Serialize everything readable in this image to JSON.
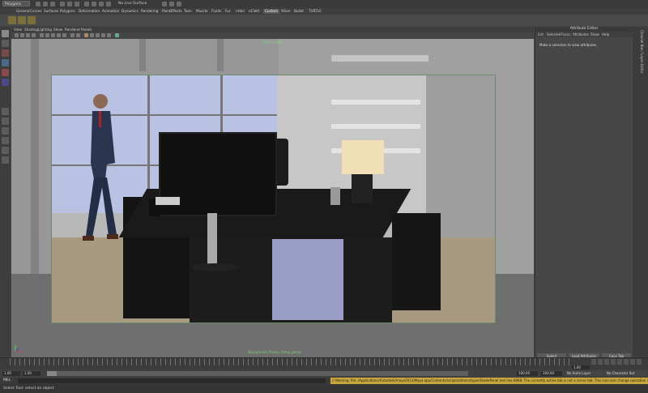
{
  "status_bar": {
    "mode": "Polygons",
    "live_surface": "No Live Surface"
  },
  "shelf_tabs": [
    "General",
    "Curves",
    "Surfaces",
    "Polygons",
    "Deformation",
    "Animation",
    "Dynamics",
    "Rendering",
    "PaintEffects",
    "Toon",
    "Muscle",
    "Fluids",
    "Fur",
    "nHair",
    "nCloth",
    "Custom",
    "XGen",
    "Bullet",
    "TURTLE"
  ],
  "active_shelf_tab": "Custom",
  "panel_menu": [
    "View",
    "Shading",
    "Lighting",
    "Show",
    "Renderer",
    "Panels"
  ],
  "viewport": {
    "top_label": "1024 x 1080",
    "bottom_label": "Background_Planes_Setup_persp"
  },
  "attribute_editor": {
    "title": "Attribute Editor",
    "menu": [
      "List",
      "Selected",
      "Focus",
      "Attributes",
      "Show",
      "Help"
    ],
    "message": "Make a selection to view attributes.",
    "buttons": [
      "Select",
      "Load Attributes",
      "Copy Tab"
    ]
  },
  "side_tabs": [
    "Channel Box / Layer Editor"
  ],
  "time_slider": {
    "current_frame": "1.00"
  },
  "range_slider": {
    "start": "1.00",
    "inner_start": "1.00",
    "inner_end": "100.00",
    "end": "100.00",
    "anim_layer": "No Anim Layer",
    "char_set": "No Character Set"
  },
  "warning": "// Warning: file: /Applications/Autodesk/maya2013/Maya.app/Contents/scripts/others/hyperShadePanel.mel line 6868: The currently active tab is not a scene tab. This icon-size change operation is not implemented for this tab.",
  "command_line": {
    "label": "MEL"
  },
  "help_line": "Select Tool: select an object"
}
